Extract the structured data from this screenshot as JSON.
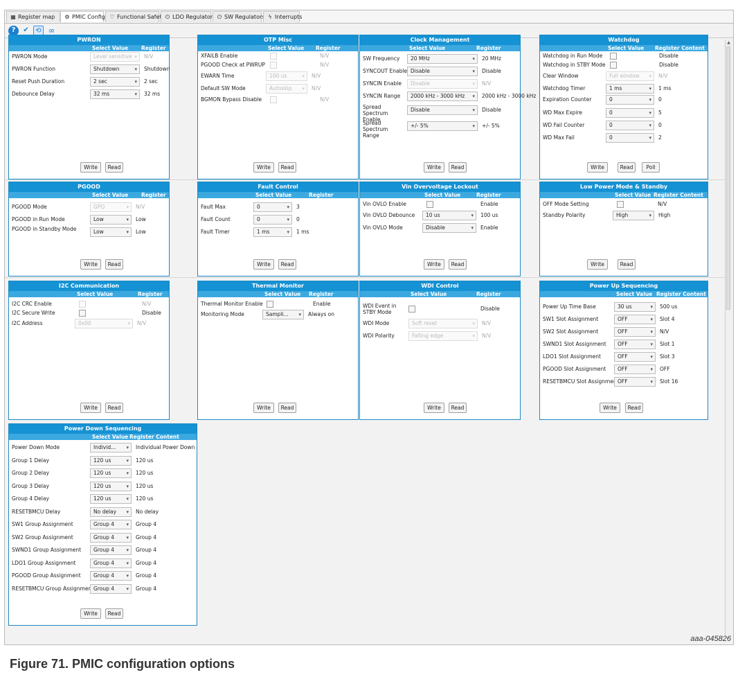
{
  "tabs": [
    {
      "icon": "register-map-icon",
      "glyph": "▦",
      "label": "Register map"
    },
    {
      "icon": "gear-icon",
      "glyph": "⚙",
      "label": "PMIC Config"
    },
    {
      "icon": "shield-icon",
      "glyph": "♡",
      "label": "Functional Safety"
    },
    {
      "icon": "power-icon",
      "glyph": "⏻",
      "label": "LDO Regulators"
    },
    {
      "icon": "power-icon",
      "glyph": "⏻",
      "label": "SW Regulators"
    },
    {
      "icon": "lightning-icon",
      "glyph": "ϟ",
      "label": "Interrupts"
    }
  ],
  "toolbar": [
    {
      "icon": "help-icon",
      "glyph": "?"
    },
    {
      "icon": "checkmark-icon",
      "glyph": "✔"
    },
    {
      "icon": "refresh-icon",
      "glyph": "⟲"
    },
    {
      "icon": "infinity-icon",
      "glyph": "∞"
    }
  ],
  "colors": {
    "title_bar": "#1592d3",
    "header_bar": "#3ba8e0",
    "border": "#1a8ac6"
  },
  "header": {
    "select": "Select Value",
    "register": "Register Content"
  },
  "buttons": {
    "write": "Write",
    "read": "Read",
    "poll": "Poll"
  },
  "panels": [
    {
      "title": "PWRON",
      "rows": [
        {
          "label": "PWRON Mode",
          "type": "select",
          "value": "Level sensitive",
          "disabled": true,
          "reg": "N/V"
        },
        {
          "label": "PWRON Function",
          "type": "select",
          "value": "Shutdown",
          "disabled": false,
          "reg": "Shutdown"
        },
        {
          "label": "Reset Push Duration",
          "type": "select",
          "value": "2 sec",
          "disabled": false,
          "reg": "2 sec"
        },
        {
          "label": "Debounce Delay",
          "type": "select",
          "value": "32 ms",
          "disabled": false,
          "reg": "32 ms"
        }
      ],
      "buttons": [
        "Write",
        "Read"
      ]
    },
    {
      "title": "OTP Misc",
      "rows": [
        {
          "label": "XFAILB Enable",
          "type": "check",
          "disabled": true,
          "reg": "N/V"
        },
        {
          "label": "PGOOD Check at PWRUP",
          "type": "check",
          "disabled": true,
          "reg": "N/V"
        },
        {
          "label": "EWARN Time",
          "type": "select",
          "value": "100 us",
          "disabled": true,
          "reg": "N/V"
        },
        {
          "label": "Default SW Mode",
          "type": "select",
          "value": "Autoskip",
          "disabled": true,
          "reg": "N/V"
        },
        {
          "label": "BGMON Bypass Disable",
          "type": "check",
          "disabled": true,
          "reg": "N/V"
        }
      ],
      "buttons": [
        "Write",
        "Read"
      ]
    },
    {
      "title": "Clock Management",
      "rows": [
        {
          "label": "SW Frequency",
          "type": "select",
          "value": "20 MHz",
          "disabled": false,
          "reg": "20 MHz"
        },
        {
          "label": "SYNCOUT Enable",
          "type": "select",
          "value": "Disable",
          "disabled": false,
          "reg": "Disable"
        },
        {
          "label": "SYNCIN Enable",
          "type": "select",
          "value": "Disable",
          "disabled": true,
          "reg": "N/V"
        },
        {
          "label": "SYNCIN Range",
          "type": "select",
          "value": "2000 kHz - 3000 kHz",
          "disabled": false,
          "reg": "2000 kHz - 3000 kHz"
        },
        {
          "label": "Spread Spectrum Enable",
          "type": "select",
          "value": "Disable",
          "disabled": false,
          "reg": "Disable"
        },
        {
          "label": "Spread Spectrum Range",
          "type": "select",
          "value": "+/- 5%",
          "disabled": false,
          "reg": "+/- 5%"
        }
      ],
      "buttons": [
        "Write",
        "Read"
      ]
    },
    {
      "title": "Watchdog",
      "rows": [
        {
          "label": "Watchdog in Run Mode",
          "type": "check",
          "disabled": false,
          "reg": "Disable"
        },
        {
          "label": "Watchdog in STBY Mode",
          "type": "check",
          "disabled": false,
          "reg": "Disable"
        },
        {
          "label": "Clear Window",
          "type": "select",
          "value": "Full window",
          "disabled": true,
          "reg": "N/V"
        },
        {
          "label": "Watchdog Timer",
          "type": "select",
          "value": "1 ms",
          "disabled": false,
          "reg": "1 ms"
        },
        {
          "label": "Expiration Counter",
          "type": "select",
          "value": "0",
          "disabled": false,
          "reg": "0"
        },
        {
          "label": "WD Max Expire",
          "type": "select",
          "value": "0",
          "disabled": false,
          "reg": "5"
        },
        {
          "label": "WD Fail Counter",
          "type": "select",
          "value": "0",
          "disabled": false,
          "reg": "0"
        },
        {
          "label": "WD Max Fail",
          "type": "select",
          "value": "0",
          "disabled": false,
          "reg": "2"
        }
      ],
      "buttons": [
        "Write",
        "Read",
        "Poll"
      ]
    },
    {
      "title": "PGOOD",
      "rows": [
        {
          "label": "PGOOD Mode",
          "type": "select",
          "value": "GPO",
          "disabled": true,
          "reg": "N/V"
        },
        {
          "label": "PGOOD in Run Mode",
          "type": "select",
          "value": "Low",
          "disabled": false,
          "reg": "Low"
        },
        {
          "label": "PGOOD in Standby Mode",
          "type": "select",
          "value": "Low",
          "disabled": false,
          "reg": "Low"
        }
      ],
      "buttons": [
        "Write",
        "Read"
      ]
    },
    {
      "title": "Fault Control",
      "rows": [
        {
          "label": "Fault Max",
          "type": "select",
          "value": "0",
          "disabled": false,
          "reg": "3"
        },
        {
          "label": "Fault Count",
          "type": "select",
          "value": "0",
          "disabled": false,
          "reg": "0"
        },
        {
          "label": "Fault Timer",
          "type": "select",
          "value": "1 ms",
          "disabled": false,
          "reg": "1 ms"
        }
      ],
      "buttons": [
        "Write",
        "Read"
      ]
    },
    {
      "title": "Vin Overvoltage Lockout",
      "rows": [
        {
          "label": "Vin OVLO Enable",
          "type": "check",
          "disabled": false,
          "reg": "Enable"
        },
        {
          "label": "Vin OVLO Debounce",
          "type": "select",
          "value": "10 us",
          "disabled": false,
          "reg": "100 us"
        },
        {
          "label": "Vin OVLO Mode",
          "type": "select",
          "value": "Disable",
          "disabled": false,
          "reg": "Enable"
        }
      ],
      "buttons": [
        "Write",
        "Read"
      ]
    },
    {
      "title": "Low Power Mode & Standby",
      "rows": [
        {
          "label": "OFF Mode Setting",
          "type": "check",
          "disabled": false,
          "reg": "N/V"
        },
        {
          "label": "Standby Polarity",
          "type": "select",
          "value": "High",
          "disabled": false,
          "reg": "High"
        }
      ],
      "buttons": [
        "Write",
        "Read"
      ]
    },
    {
      "title": "I2C Communication",
      "rows": [
        {
          "label": "I2C CRC Enable",
          "type": "check",
          "disabled": true,
          "reg": "N/V"
        },
        {
          "label": "I2C Secure Write",
          "type": "check",
          "disabled": false,
          "reg": "Disable"
        },
        {
          "label": "I2C Address",
          "type": "select",
          "value": "0x00",
          "disabled": true,
          "reg": "N/V"
        }
      ],
      "buttons": [
        "Write",
        "Read"
      ]
    },
    {
      "title": "Thermal Monitor",
      "rows": [
        {
          "label": "Thermal Monitor Enable",
          "type": "check",
          "disabled": false,
          "reg": "Enable"
        },
        {
          "label": "Monitoring Mode",
          "type": "select",
          "value": "Sampli...",
          "disabled": false,
          "reg": "Always on"
        }
      ],
      "buttons": [
        "Write",
        "Read"
      ]
    },
    {
      "title": "WDI Control",
      "rows": [
        {
          "label": "WDI Event in STBY Mode",
          "type": "check",
          "disabled": false,
          "reg": "Disable"
        },
        {
          "label": "WDI Mode",
          "type": "select",
          "value": "Soft reset",
          "disabled": true,
          "reg": "N/V"
        },
        {
          "label": "WDI Polarity",
          "type": "select",
          "value": "Falling edge",
          "disabled": true,
          "reg": "N/V"
        }
      ],
      "buttons": [
        "Write",
        "Read"
      ]
    },
    {
      "title": "Power Up Sequencing",
      "rows": [
        {
          "label": "Power Up Time Base",
          "type": "select",
          "value": "30 us",
          "disabled": false,
          "reg": "500 us"
        },
        {
          "label": "SW1 Slot Assignment",
          "type": "select",
          "value": "OFF",
          "disabled": false,
          "reg": "Slot 4"
        },
        {
          "label": "SW2 Slot Assignment",
          "type": "select",
          "value": "OFF",
          "disabled": false,
          "reg": "N/V"
        },
        {
          "label": "SWND1 Slot Assignment",
          "type": "select",
          "value": "OFF",
          "disabled": false,
          "reg": "Slot 1"
        },
        {
          "label": "LDO1 Slot Assignment",
          "type": "select",
          "value": "OFF",
          "disabled": false,
          "reg": "Slot 3"
        },
        {
          "label": "PGOOD Slot Assignment",
          "type": "select",
          "value": "OFF",
          "disabled": false,
          "reg": "OFF"
        },
        {
          "label": "RESETBMCU Slot Assignment",
          "type": "select",
          "value": "OFF",
          "disabled": false,
          "reg": "Slot 16"
        }
      ],
      "buttons": [
        "Write",
        "Read"
      ]
    },
    {
      "title": "Power Down Sequencing",
      "rows": [
        {
          "label": "Power Down Mode",
          "type": "select",
          "value": "Individ...",
          "disabled": false,
          "reg": "Individual Power Down"
        },
        {
          "label": "Group 1 Delay",
          "type": "select",
          "value": "120 us",
          "disabled": false,
          "reg": "120 us"
        },
        {
          "label": "Group 2 Delay",
          "type": "select",
          "value": "120 us",
          "disabled": false,
          "reg": "120 us"
        },
        {
          "label": "Group 3 Delay",
          "type": "select",
          "value": "120 us",
          "disabled": false,
          "reg": "120 us"
        },
        {
          "label": "Group 4 Delay",
          "type": "select",
          "value": "120 us",
          "disabled": false,
          "reg": "120 us"
        },
        {
          "label": "RESETBMCU Delay",
          "type": "select",
          "value": "No delay",
          "disabled": false,
          "reg": "No delay"
        },
        {
          "label": "SW1 Group Assignment",
          "type": "select",
          "value": "Group 4",
          "disabled": false,
          "reg": "Group 4"
        },
        {
          "label": "SW2 Group Assignment",
          "type": "select",
          "value": "Group 4",
          "disabled": false,
          "reg": "Group 4"
        },
        {
          "label": "SWND1 Group Assignment",
          "type": "select",
          "value": "Group 4",
          "disabled": false,
          "reg": "Group 4"
        },
        {
          "label": "LDO1 Group Assignment",
          "type": "select",
          "value": "Group 4",
          "disabled": false,
          "reg": "Group 4"
        },
        {
          "label": "PGOOD Group Assignment",
          "type": "select",
          "value": "Group 4",
          "disabled": false,
          "reg": "Group 4"
        },
        {
          "label": "RESETBMCU Group Assignment",
          "type": "select",
          "value": "Group 4",
          "disabled": false,
          "reg": "Group 4"
        }
      ],
      "buttons": [
        "Write",
        "Read"
      ]
    }
  ],
  "figure": {
    "ref": "aaa-045826",
    "caption": "Figure 71.  PMIC configuration options"
  }
}
